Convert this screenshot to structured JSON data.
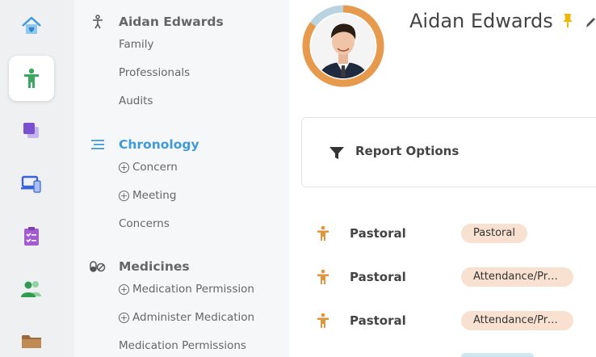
{
  "rail": {
    "items": [
      {
        "icon": "home-icon",
        "active": false
      },
      {
        "icon": "child-icon",
        "active": true
      },
      {
        "icon": "layers-icon",
        "active": false
      },
      {
        "icon": "devices-icon",
        "active": false
      },
      {
        "icon": "clipboard-icon",
        "active": false
      },
      {
        "icon": "people-icon",
        "active": false
      },
      {
        "icon": "folder-icon",
        "active": false
      }
    ]
  },
  "nav": {
    "profile_heading": "Aidan Edwards",
    "family": "Family",
    "professionals": "Professionals",
    "audits": "Audits",
    "chronology_heading": "Chronology",
    "concern": "Concern",
    "meeting": "Meeting",
    "concerns": "Concerns",
    "medicines_heading": "Medicines",
    "medication_permission": "Medication Permission",
    "administer_medication": "Administer Medication",
    "medication_permissions": "Medication Permissions"
  },
  "profile": {
    "name": "Aidan Edwards",
    "ring_color": "#e89a4c",
    "ring_track_color": "#b9d4e0"
  },
  "report": {
    "title": "Report Options"
  },
  "entries": [
    {
      "label": "Pastoral",
      "tag": "Pastoral"
    },
    {
      "label": "Pastoral",
      "tag": "Attendance/Pre..."
    },
    {
      "label": "Pastoral",
      "tag": "Attendance/Pre..."
    }
  ],
  "colors": {
    "accent": "#3f9ad6",
    "pin": "#f2b705",
    "badge_bg": "#f8e1d0",
    "entry_icon": "#e0953c"
  }
}
